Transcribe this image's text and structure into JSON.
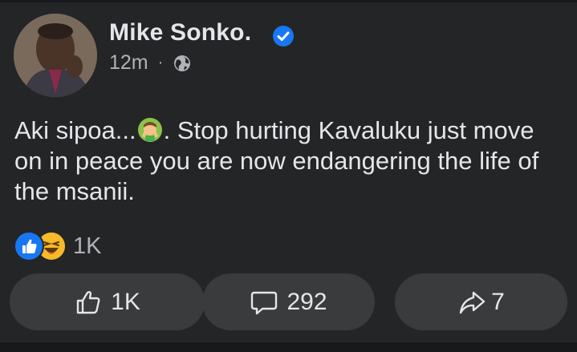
{
  "post": {
    "author": "Mike Sonko.",
    "time": "12m",
    "separator": "·",
    "text_before_emoji": "Aki sipoa...",
    "text_after_emoji": ". Stop hurting Kavaluku just move on in peace you are now endangering the life of the msanii.",
    "inline_emoji": "face-palm-hands-emoji",
    "audience_icon": "globe-icon",
    "verified_icon": "verified-badge-icon"
  },
  "reactions": {
    "types": [
      "like",
      "haha"
    ],
    "count": "1K"
  },
  "actions": {
    "like_count": "1K",
    "comment_count": "292",
    "share_count": "7"
  },
  "colors": {
    "background": "#242526",
    "text": "#e4e6eb",
    "secondary_text": "#b0b3b8",
    "button_bg": "#3a3b3c",
    "verified_blue": "#1877f2",
    "haha_yellow": "#f7b928"
  }
}
